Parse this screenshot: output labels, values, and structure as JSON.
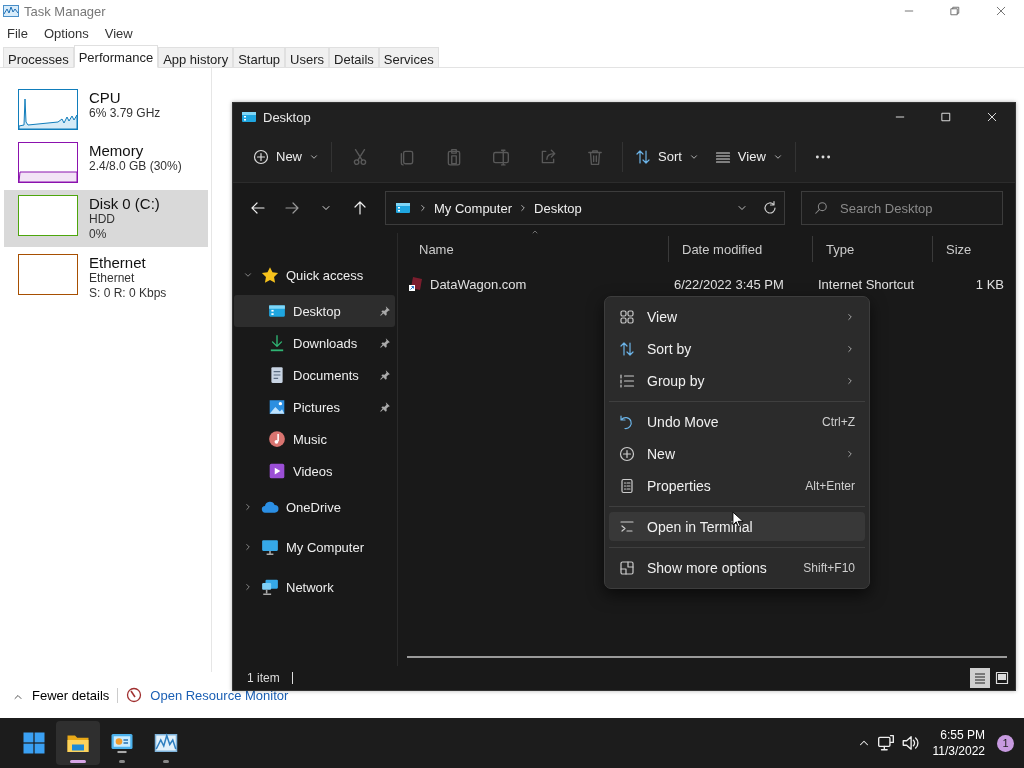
{
  "task_manager": {
    "title": "Task Manager",
    "menu": [
      "File",
      "Options",
      "View"
    ],
    "tabs": [
      {
        "label": "Processes",
        "selected": false
      },
      {
        "label": "Performance",
        "selected": true
      },
      {
        "label": "App history",
        "selected": false
      },
      {
        "label": "Startup",
        "selected": false
      },
      {
        "label": "Users",
        "selected": false
      },
      {
        "label": "Details",
        "selected": false
      },
      {
        "label": "Services",
        "selected": false
      }
    ],
    "resources": [
      {
        "kind": "cpu",
        "name": "CPU",
        "details": [
          "6% 3.79 GHz"
        ],
        "color": "#117dbb",
        "selected": false
      },
      {
        "kind": "memory",
        "name": "Memory",
        "details": [
          "2.4/8.0 GB (30%)"
        ],
        "color": "#8b12ae",
        "selected": false
      },
      {
        "kind": "disk",
        "name": "Disk 0 (C:)",
        "details": [
          "HDD",
          "0%"
        ],
        "color": "#4da60c",
        "selected": true
      },
      {
        "kind": "network",
        "name": "Ethernet",
        "details": [
          "Ethernet",
          "S: 0 R: 0 Kbps"
        ],
        "color": "#a74f01",
        "selected": false
      }
    ],
    "footer": {
      "fewer_details": "Fewer details",
      "resource_monitor": "Open Resource Monitor"
    }
  },
  "explorer": {
    "title": "Desktop",
    "toolbar": [
      {
        "kind": "new",
        "label": "New",
        "disabled": false
      },
      {
        "kind": "cut",
        "disabled": true
      },
      {
        "kind": "copy",
        "disabled": true
      },
      {
        "kind": "paste",
        "disabled": true
      },
      {
        "kind": "rename",
        "disabled": true
      },
      {
        "kind": "share",
        "disabled": true
      },
      {
        "kind": "delete",
        "disabled": true
      },
      {
        "kind": "sort",
        "label": "Sort",
        "disabled": false
      },
      {
        "kind": "view",
        "label": "View",
        "disabled": false
      },
      {
        "kind": "more",
        "disabled": false
      }
    ],
    "breadcrumbs": [
      "My Computer",
      "Desktop"
    ],
    "search": {
      "placeholder": "Search Desktop"
    },
    "navigation": [
      {
        "kind": "star",
        "label": "Quick access",
        "expanded": true,
        "selected": false,
        "children": [
          {
            "kind": "desktop",
            "label": "Desktop",
            "pinned": true,
            "selected": true
          },
          {
            "kind": "downloads",
            "label": "Downloads",
            "pinned": true,
            "selected": false
          },
          {
            "kind": "documents",
            "label": "Documents",
            "pinned": true,
            "selected": false
          },
          {
            "kind": "pictures",
            "label": "Pictures",
            "pinned": true,
            "selected": false
          },
          {
            "kind": "music",
            "label": "Music",
            "pinned": false,
            "selected": false
          },
          {
            "kind": "videos",
            "label": "Videos",
            "pinned": false,
            "selected": false
          }
        ]
      },
      {
        "kind": "cloud",
        "label": "OneDrive",
        "expanded": false,
        "selected": false
      },
      {
        "kind": "computer",
        "label": "My Computer",
        "expanded": false,
        "selected": false
      },
      {
        "kind": "network",
        "label": "Network",
        "expanded": false,
        "selected": false
      }
    ],
    "columns": [
      "Name",
      "Date modified",
      "Type",
      "Size"
    ],
    "rows": [
      {
        "name": "DataWagon.com",
        "date_modified": "6/22/2022 3:45 PM",
        "type": "Internet Shortcut",
        "size": "1 KB",
        "selected": false
      }
    ],
    "status": "1 item",
    "view_modes": [
      {
        "kind": "details",
        "selected": true
      },
      {
        "kind": "tiles",
        "selected": false
      }
    ]
  },
  "context_menu": [
    {
      "kind": "view",
      "label": "View",
      "submenu": true,
      "highlighted": false
    },
    {
      "kind": "sort",
      "label": "Sort by",
      "submenu": true,
      "highlighted": false
    },
    {
      "kind": "group",
      "label": "Group by",
      "submenu": true,
      "highlighted": false
    },
    {
      "kind": "separator"
    },
    {
      "kind": "undo",
      "label": "Undo Move",
      "shortcut": "Ctrl+Z",
      "submenu": false,
      "highlighted": false
    },
    {
      "kind": "new",
      "label": "New",
      "submenu": true,
      "highlighted": false
    },
    {
      "kind": "properties",
      "label": "Properties",
      "shortcut": "Alt+Enter",
      "submenu": false,
      "highlighted": false
    },
    {
      "kind": "separator"
    },
    {
      "kind": "terminal",
      "label": "Open in Terminal",
      "submenu": false,
      "highlighted": true
    },
    {
      "kind": "separator"
    },
    {
      "kind": "more",
      "label": "Show more options",
      "shortcut": "Shift+F10",
      "submenu": false,
      "highlighted": false
    }
  ],
  "taskbar": {
    "apps": [
      {
        "kind": "start",
        "running": false,
        "active": false
      },
      {
        "kind": "explorer",
        "running": true,
        "active": true
      },
      {
        "kind": "control-panel",
        "running": true,
        "active": false
      },
      {
        "kind": "task-manager",
        "running": true,
        "active": false
      }
    ],
    "time": "6:55 PM",
    "date": "11/3/2022",
    "notifications": "1"
  }
}
